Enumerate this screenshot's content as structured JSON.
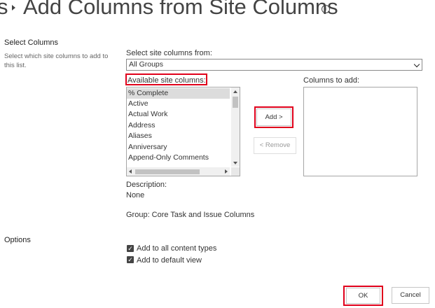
{
  "header": {
    "partial_glyph": "s",
    "title": "Add Columns from Site Columns",
    "info_icon_glyph": "i"
  },
  "select_columns_section": {
    "title": "Select Columns",
    "description": "Select which site columns to add to this list.",
    "select_from_label": "Select site columns from:",
    "group_dropdown_value": "All Groups",
    "available_label": "Available site columns:",
    "available_items": [
      "% Complete",
      "Active",
      "Actual Work",
      "Address",
      "Aliases",
      "Anniversary",
      "Append-Only Comments"
    ],
    "selected_item_index": 0,
    "available_scroll_position": 0.05,
    "add_button": "Add >",
    "remove_button": "< Remove",
    "columns_to_add_label": "Columns to add:",
    "description_label": "Description:",
    "description_value": "None",
    "group_text": "Group: Core Task and Issue Columns"
  },
  "options_section": {
    "title": "Options",
    "checkboxes": [
      {
        "label": "Add to all content types",
        "checked": true
      },
      {
        "label": "Add to default view",
        "checked": true
      }
    ]
  },
  "footer": {
    "ok_button": "OK",
    "cancel_button": "Cancel"
  },
  "highlight_color": "#e0001b"
}
